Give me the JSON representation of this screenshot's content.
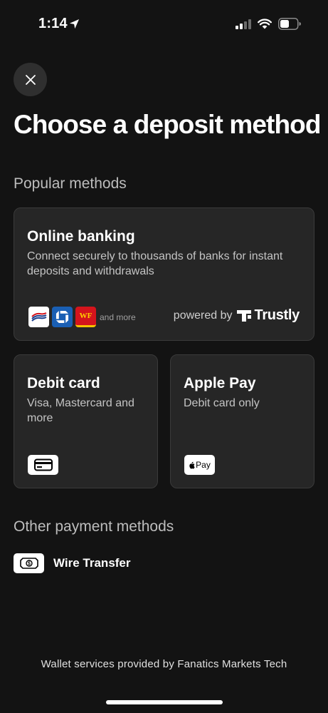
{
  "status_bar": {
    "time": "1:14",
    "icons": [
      "location-arrow-icon",
      "signal-icon",
      "wifi-icon",
      "battery-icon"
    ]
  },
  "header": {
    "close_icon": "close-icon",
    "title": "Choose a deposit method"
  },
  "popular": {
    "section_title": "Popular methods",
    "online_banking": {
      "title": "Online banking",
      "description": "Connect securely to thousands of banks for instant deposits and withdrawals",
      "banks": [
        "bank-of-america-logo",
        "chase-logo",
        "wells-fargo-logo"
      ],
      "wf_text": "WF",
      "and_more": "and more",
      "powered_by": "powered by",
      "provider": "Trustly"
    },
    "debit_card": {
      "title": "Debit card",
      "description": "Visa, Mastercard and more",
      "icon": "credit-card-icon"
    },
    "apple_pay": {
      "title": "Apple Pay",
      "description": "Debit card only",
      "badge_text": "Pay",
      "icon": "apple-pay-icon"
    }
  },
  "other": {
    "section_title": "Other payment methods",
    "wire_transfer": {
      "label": "Wire Transfer",
      "icon": "banknote-icon"
    }
  },
  "footer": {
    "text": "Wallet services provided by Fanatics Markets Tech"
  },
  "colors": {
    "background": "#131313",
    "card": "#262626",
    "card_border": "#3a3a3a",
    "muted_text": "#bdbdbd"
  }
}
